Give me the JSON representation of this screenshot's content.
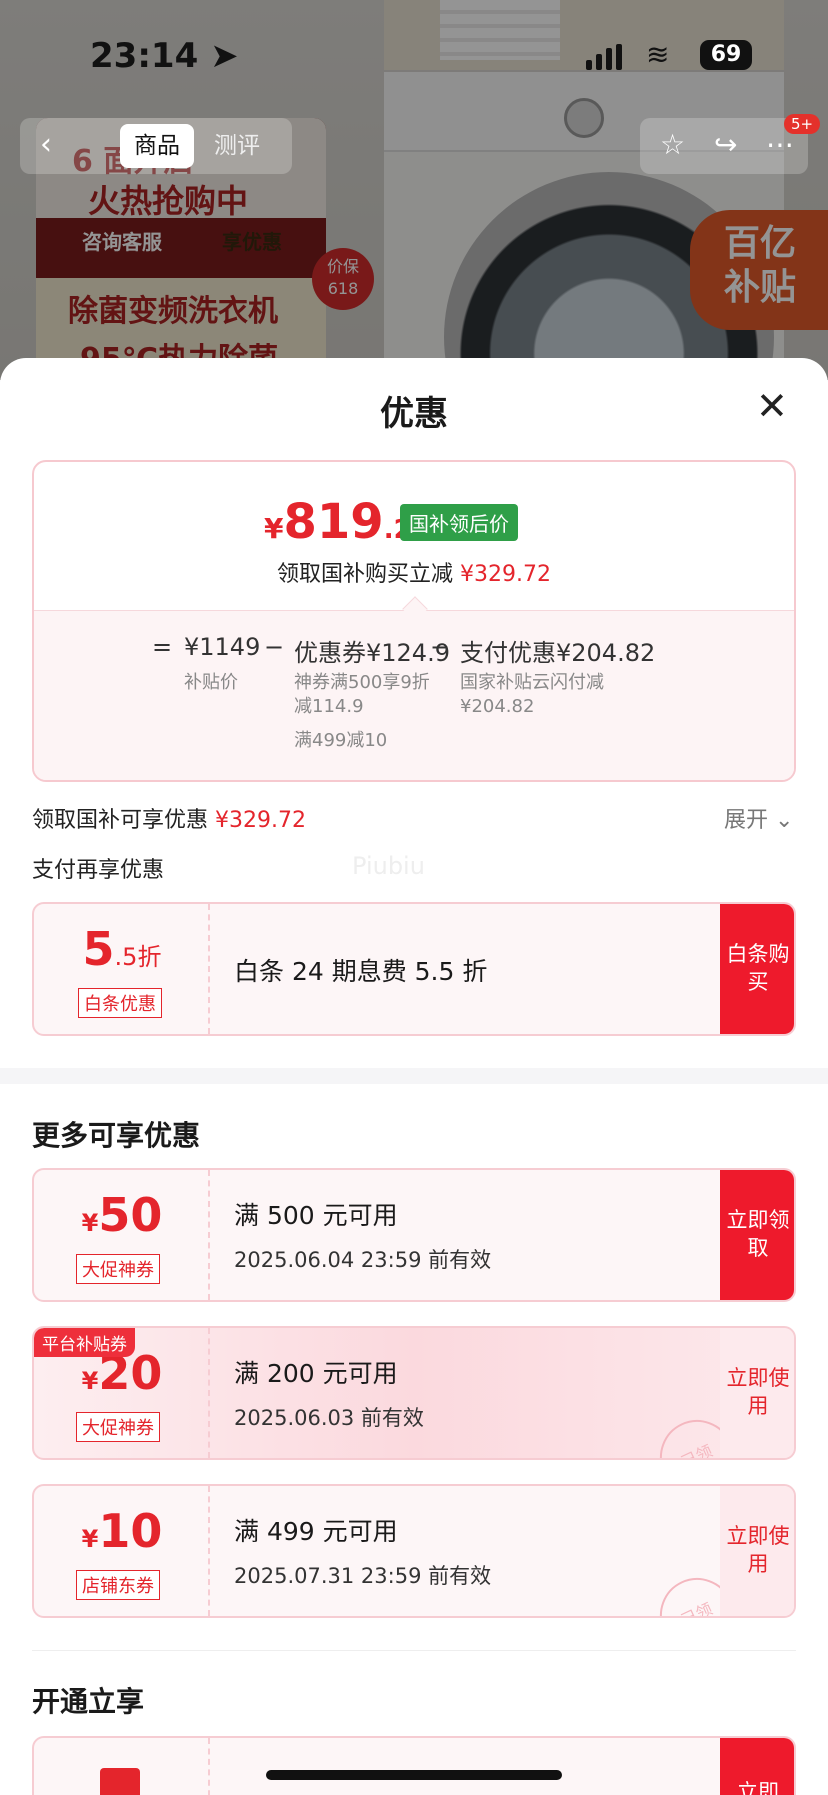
{
  "status_bar": {
    "time": "23:14",
    "battery": "69"
  },
  "nav": {
    "tab_goods": "商品",
    "tab_review": "测评",
    "cart_badge": "5+"
  },
  "background_poster": {
    "line1": "6 面开启",
    "line2": "火热抢购中",
    "btn_left": "咨询客服",
    "btn_right": "享优惠",
    "line3": "除菌变频洗衣机",
    "line4": "95℃热力除菌",
    "price_protect_1": "价保",
    "price_protect_2": "618",
    "subsidy_1": "百亿",
    "subsidy_2": "补贴"
  },
  "sheet": {
    "title": "优惠",
    "price": {
      "yen": "¥",
      "integer": "819",
      "decimal": ".28",
      "tag": "国补领后价",
      "sub_text": "领取国补购买立减",
      "sub_amount": "¥329.72"
    },
    "calc": {
      "eq": "=",
      "base": "¥1149",
      "base_label": "补贴价",
      "minus1": "−",
      "coupon": "优惠券¥124.9",
      "coupon_d1": "神券满500享9折",
      "coupon_d2": "减114.9",
      "coupon_d3": "满499减10",
      "minus2": "−",
      "pay": "支付优惠¥204.82",
      "pay_d1": "国家补贴云闪付减",
      "pay_d2": "¥204.82"
    },
    "guobu_row": {
      "label": "领取国补可享优惠",
      "amount": "¥329.72",
      "expand": "展开"
    },
    "pay_section_title": "支付再享优惠",
    "watermark": "Piubiu",
    "baitiao": {
      "num": "5",
      "suffix": ".5折",
      "tag": "白条优惠",
      "desc": "白条 24 期息费 5.5 折",
      "action": "白条购买"
    },
    "more_title": "更多可享优惠",
    "coupons": [
      {
        "yen": "¥",
        "amount": "50",
        "tag": "大促神券",
        "condition": "满 500 元可用",
        "expiry": "2025.06.04 23:59 前有效",
        "action": "立即领取",
        "corner": ""
      },
      {
        "yen": "¥",
        "amount": "20",
        "tag": "大促神券",
        "condition": "满 200 元可用",
        "expiry": "2025.06.03 前有效",
        "action": "立即使用",
        "corner": "平台补贴券",
        "stamp": "已领"
      },
      {
        "yen": "¥",
        "amount": "10",
        "tag": "店铺东券",
        "condition": "满 499 元可用",
        "expiry": "2025.07.31 23:59 前有效",
        "action": "立即使用",
        "corner": "",
        "stamp": "已领"
      }
    ],
    "open_title": "开通立享",
    "open_action": "立即"
  },
  "colors": {
    "accent_red": "#e4252c",
    "action_red": "#ee1a2c",
    "green_tag": "#2f9f48"
  }
}
